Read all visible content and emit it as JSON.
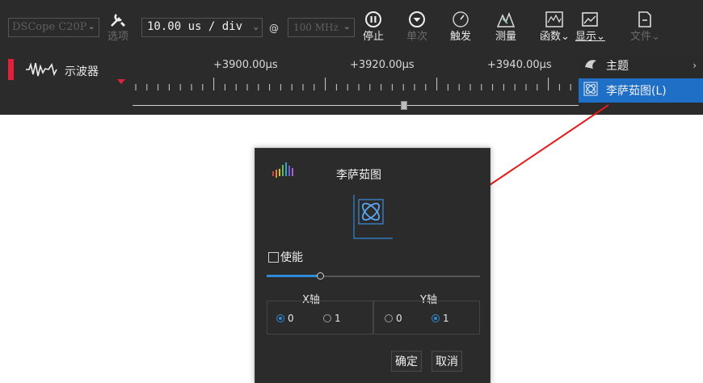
{
  "toolbar": {
    "device": "DSCope C20P",
    "options_label": "选项",
    "timebase": "10.00 us / div",
    "at": "@",
    "samplerate": "100 MHz",
    "stop_label": "停止",
    "single_label": "单次",
    "trigger_label": "触发",
    "measure_label": "测量",
    "math_label": "函数",
    "display_label": "显示",
    "file_label": "文件"
  },
  "channel": {
    "name": "示波器",
    "color": "#e0213b"
  },
  "ruler": {
    "labels": [
      "+3900.00μs",
      "+3920.00μs",
      "+3940.00μs"
    ]
  },
  "menu": {
    "items": [
      {
        "label": "主题",
        "icon": "theme-icon"
      },
      {
        "label": "李萨茹图(L)",
        "icon": "lissajous-icon",
        "selected": true
      }
    ]
  },
  "dialog": {
    "title": "李萨茹图",
    "enable_label": "使能",
    "enable_checked": false,
    "slider_value": 0.25,
    "x_axis": {
      "label": "X轴",
      "options": [
        "0",
        "1"
      ],
      "selected": "0"
    },
    "y_axis": {
      "label": "Y轴",
      "options": [
        "0",
        "1"
      ],
      "selected": "1"
    },
    "ok_label": "确定",
    "cancel_label": "取消"
  },
  "colors": {
    "accent": "#2f88d8",
    "menu_highlight": "#1f6fc7",
    "annotation_arrow": "#e31b1b"
  }
}
